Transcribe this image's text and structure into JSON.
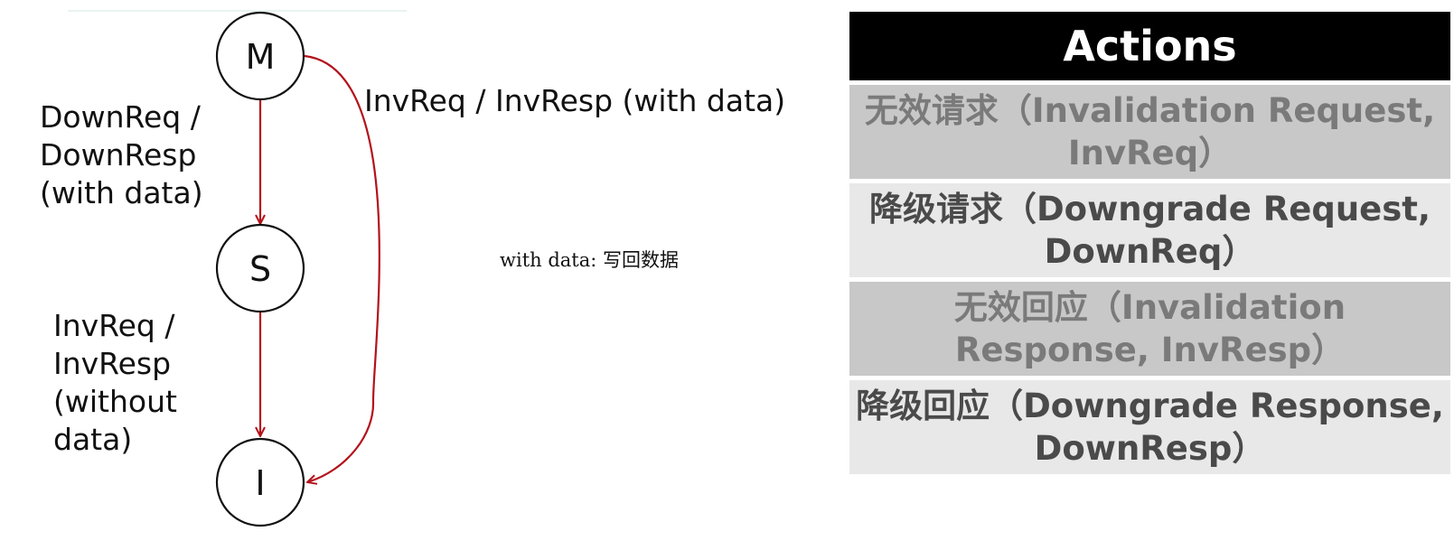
{
  "states": [
    {
      "id": "M",
      "letter": "M"
    },
    {
      "id": "S",
      "letter": "S"
    },
    {
      "id": "I",
      "letter": "I"
    }
  ],
  "transitions": {
    "m_to_s": [
      "DownReq /",
      "DownResp",
      "(with data)"
    ],
    "s_to_i": [
      "InvReq /",
      "InvResp",
      "(without",
      "data)"
    ],
    "m_to_i": "InvReq / InvResp (with data)"
  },
  "note": "with data: 写回数据",
  "actions": {
    "header": "Actions",
    "rows": [
      {
        "line1": "无效请求（Invalidation Request,",
        "line2": "InvReq）",
        "style": "dark"
      },
      {
        "line1": "降级请求（Downgrade Request,",
        "line2": "DownReq）",
        "style": "light"
      },
      {
        "line1": "无效回应（Invalidation",
        "line2": "Response, InvResp）",
        "style": "dark"
      },
      {
        "line1": "降级回应（Downgrade Response,",
        "line2": "DownResp）",
        "style": "light"
      }
    ]
  },
  "colors": {
    "edge": "#b3121b",
    "header_bg": "#000000",
    "row_dark_bg": "#c8c8c8",
    "row_light_bg": "#e8e8e8"
  }
}
